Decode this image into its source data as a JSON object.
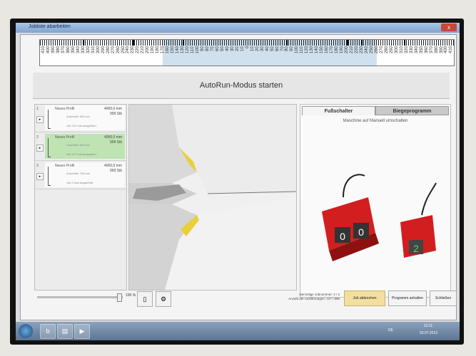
{
  "window": {
    "title": "Jobliste abarbeiten",
    "close": "x"
  },
  "ruler": {
    "labels": [
      "410",
      "400",
      "390",
      "380",
      "370",
      "360",
      "350",
      "340",
      "330",
      "320",
      "310",
      "300",
      "290",
      "280",
      "270",
      "260",
      "250",
      "240",
      "230",
      "220",
      "210",
      "200",
      "190",
      "180",
      "170",
      "160",
      "150",
      "140",
      "130",
      "120",
      "110",
      "100",
      "90",
      "80",
      "70",
      "60",
      "50",
      "40",
      "30",
      "20",
      "10",
      "0",
      "10",
      "20",
      "30",
      "40",
      "50",
      "60",
      "70",
      "80",
      "90",
      "100",
      "110",
      "120",
      "130",
      "140",
      "150",
      "160",
      "170",
      "180",
      "190",
      "200",
      "210",
      "220",
      "230",
      "240",
      "250",
      "260",
      "270",
      "280",
      "290",
      "300",
      "310",
      "320",
      "330",
      "340",
      "350",
      "360",
      "370",
      "380",
      "390",
      "400",
      "410"
    ]
  },
  "header": {
    "title": "AutoRun-Modus starten"
  },
  "jobs": [
    {
      "num": "1",
      "name": "Neues Profil",
      "length": "4000,0 mm",
      "count": "999 Stk",
      "sub1": "Zuschnitt: 600 mm",
      "sub2": "Job 121 mal ausgeführt"
    },
    {
      "num": "2",
      "name": "Neues Profil",
      "length": "4000,0 mm",
      "count": "999 Stk",
      "sub1": "Zuschnitt: 600 mm",
      "sub2": "Job 127 mal ausgeführt"
    },
    {
      "num": "3",
      "name": "Neues Profil",
      "length": "4000,0 mm",
      "count": "999 Stk",
      "sub1": "Zuschnitt: 700 mm",
      "sub2": "Job 2 mal ausgeführt"
    }
  ],
  "right": {
    "tabs": [
      "Fußschalter",
      "Biegeprogramm"
    ],
    "hint": "Maschine auf Manuell umschalten",
    "pedal_left": [
      "0",
      "0"
    ],
    "pedal_right": "2"
  },
  "footer": {
    "zoom": "100 %",
    "info_line1": "Derzeitige Jobnummer: 2 / 3",
    "info_line2": "Anzahl der Ausführungen: 127 / 999",
    "btn_abort": "Job abbrechen",
    "btn_stop": "Programm anhalten",
    "btn_close": "Schließen"
  },
  "taskbar": {
    "lang": "DE",
    "time": "12:11",
    "date": "03.07.2013"
  }
}
